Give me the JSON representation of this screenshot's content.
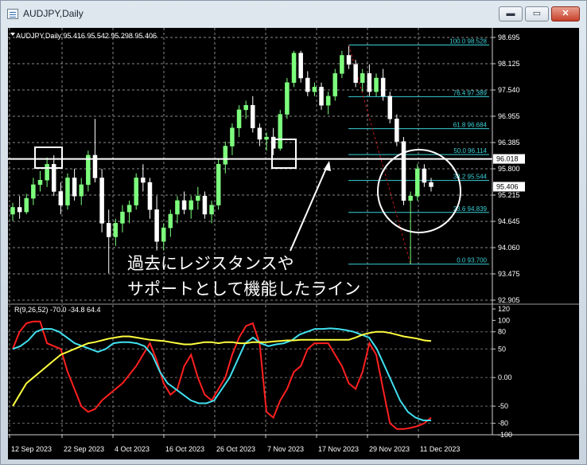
{
  "window": {
    "title": "AUDJPY,Daily",
    "buttons": {
      "minimize": "▬",
      "maximize": "▭",
      "close": "✕"
    }
  },
  "chart_header": "AUDJPY,Daily  95.416 95.542 95.298 95.406",
  "overlay_text": {
    "line1": "過去にレジスタンスや",
    "line2": "サポートとして機能したライン"
  },
  "price_axis": {
    "labels": [
      "98.695",
      "98.125",
      "97.540",
      "96.955",
      "96.385",
      "95.800",
      "95.215",
      "94.645",
      "94.060",
      "93.475",
      "92.905"
    ],
    "highlight": [
      {
        "text": "96.018",
        "value": 96.018
      },
      {
        "text": "95.406",
        "value": 95.406
      }
    ]
  },
  "date_axis": [
    "12 Sep 2023",
    "22 Sep 2023",
    "4 Oct 2023",
    "16 Oct 2023",
    "26 Oct 2023",
    "7 Nov 2023",
    "17 Nov 2023",
    "29 Nov 2023",
    "11 Dec 2023"
  ],
  "indicator": {
    "label": "R(9,26,52) -70.0 -34.8 64.4",
    "scale_labels": [
      "120",
      "100",
      "80",
      "50",
      "0.00",
      "-50",
      "-80",
      "-100"
    ]
  },
  "colors": {
    "bull": "#7dff7d",
    "bear": "#ffffff",
    "fib": "#3ad0d8",
    "level": "#ffffff",
    "series_fast": "#ff2020",
    "series_mid": "#40e0f0",
    "series_slow": "#ffff40"
  },
  "chart_data": [
    {
      "type": "candlestick",
      "title": "AUDJPY,Daily",
      "x": [
        "12 Sep 2023",
        "22 Sep 2023",
        "4 Oct 2023",
        "16 Oct 2023",
        "26 Oct 2023",
        "7 Nov 2023",
        "17 Nov 2023",
        "29 Nov 2023",
        "11 Dec 2023"
      ],
      "ylim": [
        92.905,
        98.695
      ],
      "ohlc": [
        [
          94.8,
          95.05,
          94.65,
          94.95
        ],
        [
          94.95,
          95.2,
          94.7,
          94.85
        ],
        [
          94.85,
          95.25,
          94.8,
          95.15
        ],
        [
          95.15,
          95.6,
          95.0,
          95.45
        ],
        [
          95.45,
          95.75,
          95.3,
          95.55
        ],
        [
          95.55,
          96.05,
          95.4,
          95.9
        ],
        [
          95.9,
          96.1,
          95.2,
          95.3
        ],
        [
          95.3,
          95.5,
          94.8,
          95.0
        ],
        [
          95.0,
          95.7,
          94.9,
          95.6
        ],
        [
          95.6,
          95.8,
          95.1,
          95.2
        ],
        [
          95.2,
          95.6,
          95.0,
          95.45
        ],
        [
          95.45,
          96.2,
          95.3,
          96.1
        ],
        [
          96.1,
          96.9,
          95.5,
          95.6
        ],
        [
          95.6,
          95.8,
          94.4,
          94.6
        ],
        [
          94.6,
          94.9,
          93.5,
          94.3
        ],
        [
          94.3,
          94.7,
          94.1,
          94.6
        ],
        [
          94.6,
          95.0,
          94.4,
          94.85
        ],
        [
          94.85,
          95.1,
          94.6,
          95.0
        ],
        [
          95.0,
          95.7,
          94.9,
          95.6
        ],
        [
          95.6,
          95.9,
          95.3,
          95.5
        ],
        [
          95.5,
          95.6,
          94.7,
          94.9
        ],
        [
          94.9,
          95.2,
          94.0,
          94.2
        ],
        [
          94.2,
          94.6,
          94.0,
          94.5
        ],
        [
          94.5,
          94.9,
          94.3,
          94.8
        ],
        [
          94.8,
          95.2,
          94.6,
          95.1
        ],
        [
          95.1,
          95.3,
          94.8,
          94.9
        ],
        [
          94.9,
          95.2,
          94.7,
          95.1
        ],
        [
          95.1,
          95.4,
          94.9,
          95.2
        ],
        [
          95.2,
          95.3,
          94.7,
          94.8
        ],
        [
          94.8,
          95.1,
          94.6,
          95.0
        ],
        [
          95.0,
          96.0,
          94.9,
          95.9
        ],
        [
          95.9,
          96.4,
          95.7,
          96.3
        ],
        [
          96.3,
          96.8,
          96.1,
          96.7
        ],
        [
          96.7,
          97.2,
          96.5,
          97.1
        ],
        [
          97.1,
          97.3,
          96.9,
          97.2
        ],
        [
          97.2,
          97.4,
          96.6,
          96.7
        ],
        [
          96.7,
          96.8,
          96.3,
          96.45
        ],
        [
          96.45,
          96.6,
          96.2,
          96.5
        ],
        [
          96.5,
          96.7,
          96.1,
          96.25
        ],
        [
          96.25,
          97.1,
          96.2,
          97.0
        ],
        [
          97.0,
          97.8,
          96.9,
          97.7
        ],
        [
          97.7,
          98.4,
          97.6,
          98.35
        ],
        [
          98.35,
          98.4,
          97.7,
          97.8
        ],
        [
          97.8,
          97.95,
          97.4,
          97.5
        ],
        [
          97.5,
          97.7,
          97.4,
          97.6
        ],
        [
          97.6,
          97.7,
          97.1,
          97.2
        ],
        [
          97.2,
          97.5,
          97.0,
          97.4
        ],
        [
          97.4,
          98.0,
          97.3,
          97.9
        ],
        [
          97.9,
          98.4,
          97.8,
          98.3
        ],
        [
          98.3,
          98.5,
          98.0,
          98.1
        ],
        [
          98.1,
          98.2,
          97.6,
          97.7
        ],
        [
          97.7,
          98.0,
          97.5,
          97.9
        ],
        [
          97.9,
          98.1,
          97.4,
          97.5
        ],
        [
          97.5,
          97.9,
          97.4,
          97.8
        ],
        [
          97.8,
          98.0,
          97.3,
          97.4
        ],
        [
          97.4,
          97.5,
          96.8,
          96.9
        ],
        [
          96.9,
          97.0,
          96.3,
          96.4
        ],
        [
          96.4,
          96.5,
          95.0,
          95.1
        ],
        [
          95.1,
          95.3,
          93.7,
          95.2
        ],
        [
          95.2,
          95.9,
          95.1,
          95.8
        ],
        [
          95.8,
          95.9,
          95.4,
          95.5
        ],
        [
          95.5,
          95.6,
          95.3,
          95.406
        ]
      ],
      "levels": [
        {
          "name": "level",
          "value": 96.018
        }
      ],
      "fib_levels": [
        {
          "label": "100.0  98.528",
          "value": 98.528
        },
        {
          "label": "76.4  97.389",
          "value": 97.389
        },
        {
          "label": "61.8  96.684",
          "value": 96.684
        },
        {
          "label": "50.0  96.114",
          "value": 96.114
        },
        {
          "label": "38.2  95.544",
          "value": 95.544
        },
        {
          "label": "23.6  94.839",
          "value": 94.839
        },
        {
          "label": "0.0  93.700",
          "value": 93.7
        }
      ]
    },
    {
      "type": "line",
      "title": "R(9,26,52) -70.0 -34.8 64.4",
      "ylim": [
        -100,
        120
      ],
      "series": [
        {
          "values": [
            50,
            80,
            95,
            98,
            98,
            60,
            55,
            50,
            10,
            -20,
            -50,
            -60,
            -55,
            -40,
            -30,
            -20,
            -10,
            5,
            20,
            40,
            60,
            30,
            -10,
            -30,
            -20,
            20,
            40,
            0,
            -30,
            -40,
            -20,
            0,
            40,
            70,
            90,
            95,
            60,
            -60,
            -70,
            -40,
            -20,
            10,
            20,
            50,
            60,
            60,
            60,
            40,
            20,
            -10,
            -20,
            10,
            60,
            40,
            -20,
            -80,
            -90,
            -90,
            -88,
            -85,
            -80,
            -70
          ]
        },
        {
          "values": [
            50,
            55,
            65,
            80,
            85,
            85,
            80,
            70,
            60,
            55,
            50,
            45,
            50,
            60,
            62,
            62,
            60,
            55,
            40,
            10,
            -10,
            -20,
            -30,
            -40,
            -45,
            -45,
            -40,
            -20,
            0,
            30,
            60,
            70,
            60,
            55,
            58,
            60,
            65,
            75,
            80,
            85,
            85,
            86,
            85,
            83,
            80,
            75,
            70,
            50,
            20,
            -10,
            -40,
            -60,
            -70,
            -75,
            -75
          ]
        },
        {
          "values": [
            -50,
            -30,
            -10,
            0,
            10,
            20,
            30,
            40,
            45,
            50,
            55,
            60,
            62,
            65,
            68,
            70,
            72,
            72,
            70,
            68,
            66,
            65,
            64,
            62,
            60,
            58,
            58,
            60,
            62,
            62,
            60,
            62,
            62,
            60,
            60,
            62,
            62,
            62,
            63,
            64,
            65,
            65,
            66,
            66,
            66,
            66,
            66,
            66,
            66,
            66,
            70,
            75,
            78,
            80,
            80,
            78,
            75,
            72,
            70,
            68,
            65,
            64
          ]
        }
      ]
    }
  ]
}
